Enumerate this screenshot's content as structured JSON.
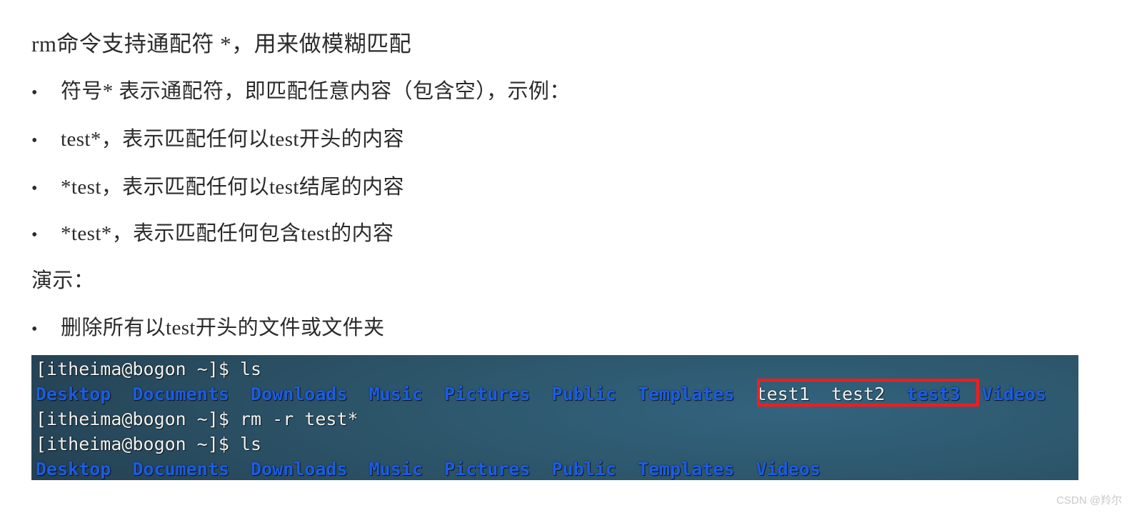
{
  "document": {
    "heading": "rm命令支持通配符 *，用来做模糊匹配",
    "bullets": [
      {
        "marker": "•",
        "text": "符号* 表示通配符，即匹配任意内容（包含空），示例："
      },
      {
        "marker": "•",
        "text": "test*，表示匹配任何以test开头的内容"
      },
      {
        "marker": "•",
        "text": "*test，表示匹配任何以test结尾的内容"
      },
      {
        "marker": "•",
        "text": "*test*，表示匹配任何包含test的内容"
      }
    ],
    "section_label": "演示：",
    "demo_bullet": {
      "marker": "•",
      "text": "删除所有以test开头的文件或文件夹"
    }
  },
  "terminal": {
    "prompt": "[itheima@bogon ~]$ ",
    "colors": {
      "directory": "#1d5ce0",
      "file": "#f2f2f2",
      "prompt": "#f2f2f2",
      "highlight_border": "#ff1a1a"
    },
    "lines": [
      {
        "type": "command",
        "tokens": [
          {
            "text": "[itheima@bogon ~]$ ",
            "kind": "prompt"
          },
          {
            "text": "ls",
            "kind": "prompt"
          }
        ]
      },
      {
        "type": "output",
        "tokens": [
          {
            "text": "Desktop",
            "kind": "dir"
          },
          {
            "text": "  ",
            "kind": "space"
          },
          {
            "text": "Documents",
            "kind": "dir"
          },
          {
            "text": "  ",
            "kind": "space"
          },
          {
            "text": "Downloads",
            "kind": "dir"
          },
          {
            "text": "  ",
            "kind": "space"
          },
          {
            "text": "Music",
            "kind": "dir"
          },
          {
            "text": "  ",
            "kind": "space"
          },
          {
            "text": "Pictures",
            "kind": "dir"
          },
          {
            "text": "  ",
            "kind": "space"
          },
          {
            "text": "Public",
            "kind": "dir"
          },
          {
            "text": "  ",
            "kind": "space"
          },
          {
            "text": "Templates",
            "kind": "dir"
          },
          {
            "text": "  ",
            "kind": "space"
          },
          {
            "text": "test1",
            "kind": "file"
          },
          {
            "text": "  ",
            "kind": "space"
          },
          {
            "text": "test2",
            "kind": "file"
          },
          {
            "text": "  ",
            "kind": "space"
          },
          {
            "text": "test3",
            "kind": "dir"
          },
          {
            "text": "  ",
            "kind": "space"
          },
          {
            "text": "Videos",
            "kind": "dir"
          }
        ]
      },
      {
        "type": "command",
        "tokens": [
          {
            "text": "[itheima@bogon ~]$ ",
            "kind": "prompt"
          },
          {
            "text": "rm -r test*",
            "kind": "prompt"
          }
        ]
      },
      {
        "type": "command",
        "tokens": [
          {
            "text": "[itheima@bogon ~]$ ",
            "kind": "prompt"
          },
          {
            "text": "ls",
            "kind": "prompt"
          }
        ]
      },
      {
        "type": "output",
        "tokens": [
          {
            "text": "Desktop",
            "kind": "dir"
          },
          {
            "text": "  ",
            "kind": "space"
          },
          {
            "text": "Documents",
            "kind": "dir"
          },
          {
            "text": "  ",
            "kind": "space"
          },
          {
            "text": "Downloads",
            "kind": "dir"
          },
          {
            "text": "  ",
            "kind": "space"
          },
          {
            "text": "Music",
            "kind": "dir"
          },
          {
            "text": "  ",
            "kind": "space"
          },
          {
            "text": "Pictures",
            "kind": "dir"
          },
          {
            "text": "  ",
            "kind": "space"
          },
          {
            "text": "Public",
            "kind": "dir"
          },
          {
            "text": "  ",
            "kind": "space"
          },
          {
            "text": "Templates",
            "kind": "dir"
          },
          {
            "text": "  ",
            "kind": "space"
          },
          {
            "text": "Videos",
            "kind": "dir"
          }
        ]
      }
    ],
    "highlight_label": "test1  test2  test3"
  },
  "watermark": "CSDN @羚尔"
}
